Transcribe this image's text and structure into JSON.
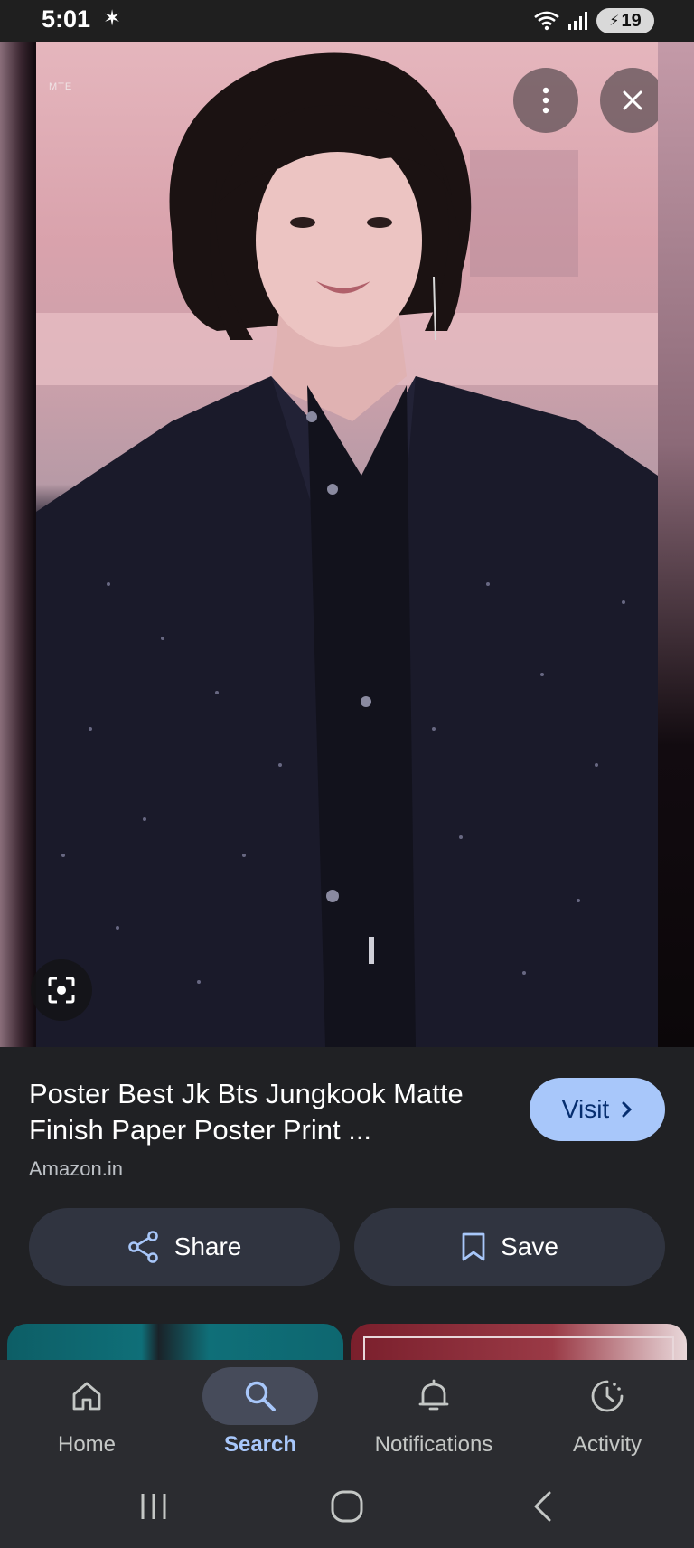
{
  "status_bar": {
    "time": "5:01",
    "battery": "19"
  },
  "viewer": {
    "watermark": "MTE"
  },
  "result": {
    "title": "Poster Best Jk Bts Jungkook Matte Finish Paper Poster Print ...",
    "source": "Amazon.in",
    "visit_label": "Visit",
    "share_label": "Share",
    "save_label": "Save"
  },
  "bottom_nav": {
    "items": [
      {
        "label": "Home",
        "icon": "home-icon"
      },
      {
        "label": "Search",
        "icon": "search-icon",
        "active": true
      },
      {
        "label": "Notifications",
        "icon": "bell-icon"
      },
      {
        "label": "Activity",
        "icon": "activity-icon"
      }
    ]
  },
  "colors": {
    "accent": "#a8c7fa",
    "background": "#202124",
    "button_bg": "#303440",
    "nav_bg": "#2b2c30"
  }
}
